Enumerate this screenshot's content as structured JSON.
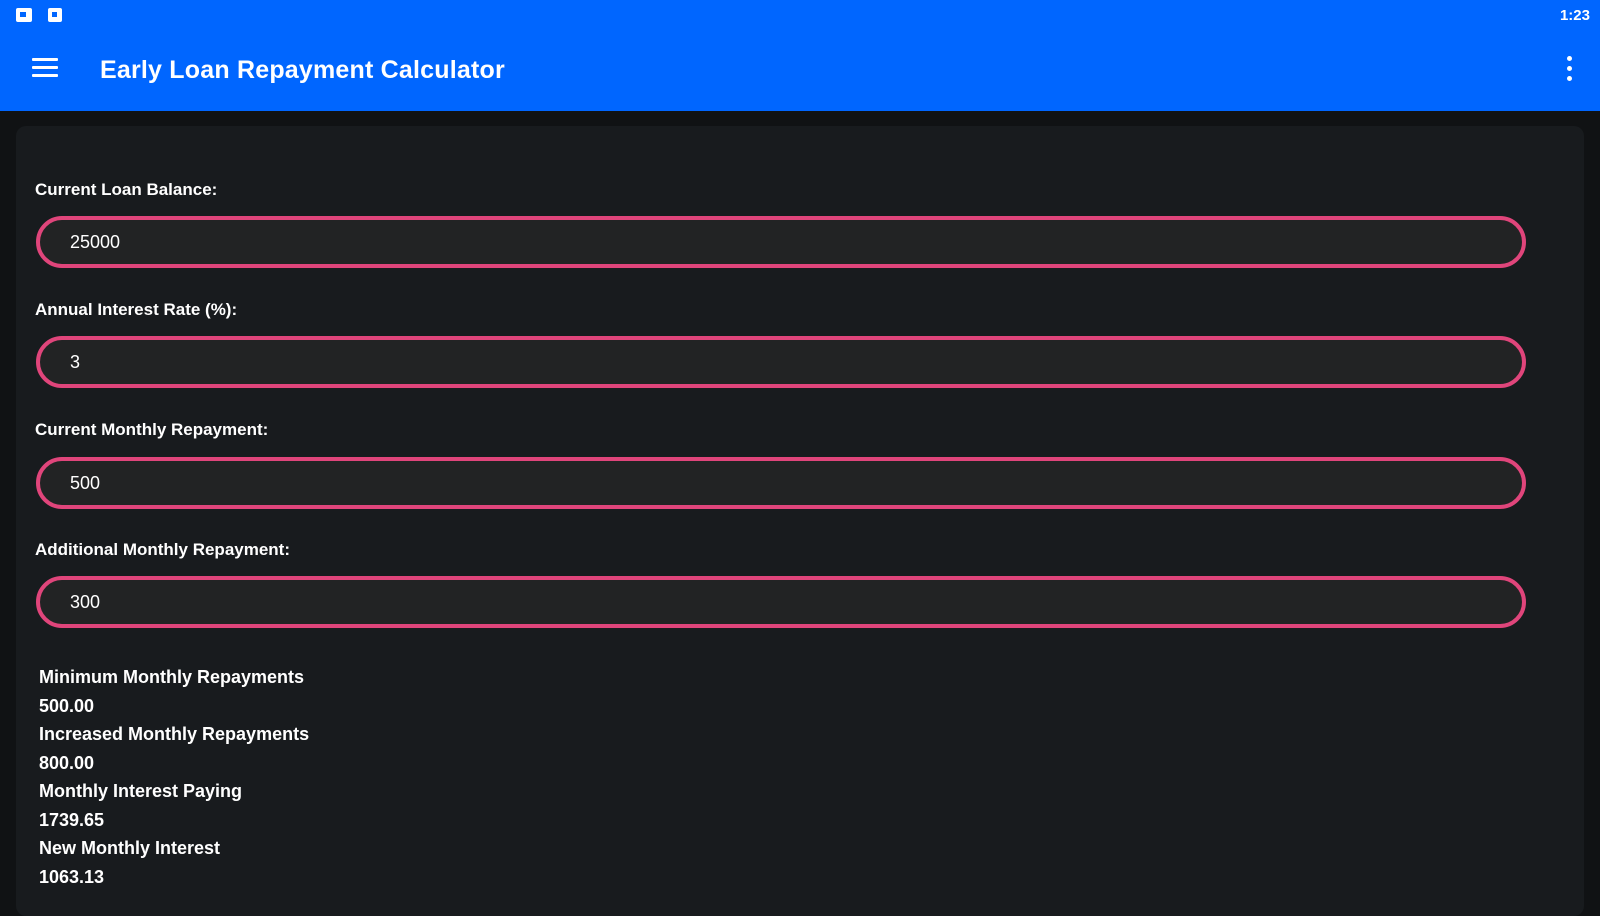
{
  "status_bar": {
    "time": "1:23",
    "icons": [
      "notification-image-icon",
      "notification-square-icon"
    ]
  },
  "app_bar": {
    "title": "Early Loan Repayment Calculator",
    "menu_icon": "hamburger-menu-icon",
    "overflow_icon": "more-vert-icon"
  },
  "form": {
    "fields": [
      {
        "label": "Current Loan Balance:",
        "value": "25000"
      },
      {
        "label": "Annual Interest Rate (%):",
        "value": "3"
      },
      {
        "label": "Current Monthly Repayment:",
        "value": "500"
      },
      {
        "label": "Additional Monthly Repayment:",
        "value": "300"
      }
    ]
  },
  "results": [
    {
      "label": "Minimum Monthly Repayments",
      "value": "500.00"
    },
    {
      "label": "Increased Monthly Repayments",
      "value": "800.00"
    },
    {
      "label": "Monthly Interest Paying",
      "value": "1739.65"
    },
    {
      "label": "New Monthly Interest",
      "value": "1063.13"
    }
  ],
  "colors": {
    "primary": "#0066ff",
    "field_border": "#e0457b",
    "background": "#101214",
    "card": "#181b1e",
    "field_fill": "#222324"
  }
}
